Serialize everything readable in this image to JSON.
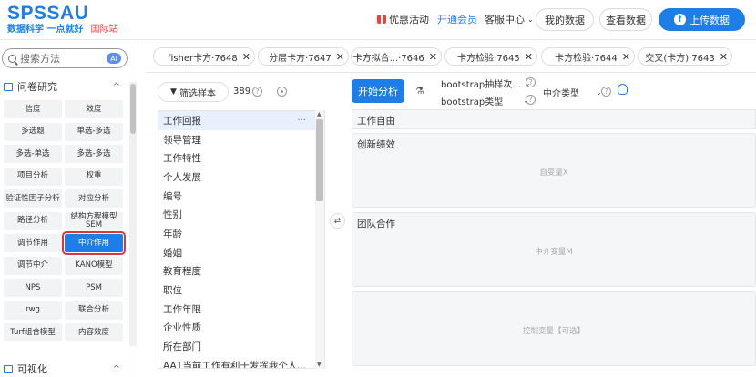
{
  "header": {
    "brand": "SPSSAU",
    "slogan": "数据科学 一点就好",
    "intl": "国际站",
    "promo": "优惠活动",
    "vip": "开通会员",
    "service": "客服中心",
    "my_data": "我的数据",
    "view_data": "查看数据",
    "upload": "上传数据"
  },
  "sidebar": {
    "search_placeholder": "搜索方法",
    "ai_badge": "AI",
    "section_title": "问卷研究",
    "section2_title": "可视化",
    "methods": [
      "信度",
      "效度",
      "多选题",
      "单选-多选",
      "多选-单选",
      "多选-多选",
      "项目分析",
      "权重",
      "验证性因子分析",
      "对应分析",
      "路径分析",
      "结构方程模型SEM",
      "调节作用",
      "中介作用",
      "调节中介",
      "KANO模型",
      "NPS",
      "PSM",
      "rwg",
      "联合分析",
      "Turf组合模型",
      "内容效度"
    ],
    "active_method": "中介作用"
  },
  "tabs": [
    "fisher卡方·7648",
    "分层卡方·7647",
    "卡方拟合...·7646",
    "卡方检验·7645",
    "卡方检验·7644",
    "交叉(卡方)·7643"
  ],
  "varpanel": {
    "filter_label": "筛选样本",
    "count": "389",
    "variables": [
      "工作回报",
      "领导管理",
      "工作特性",
      "个人发展",
      "编号",
      "性别",
      "年龄",
      "婚姻",
      "教育程度",
      "职位",
      "工作年限",
      "企业性质",
      "所在部门",
      "AA1当前工作有利于发挥我个人..."
    ]
  },
  "config": {
    "analyze": "开始分析",
    "bootstrap_samples": "bootstrap抽样次...",
    "bootstrap_type": "bootstrap类型",
    "mediation_type": "中介类型",
    "y_var": "工作自由",
    "x_title": "创新绩效",
    "x_placeholder": "自变量X",
    "m_title": "团队合作",
    "m_placeholder": "中介变量M",
    "c_placeholder": "控制变量【可选】"
  },
  "colors": {
    "accent": "#1e7ee8",
    "highlight": "#d9383a"
  }
}
